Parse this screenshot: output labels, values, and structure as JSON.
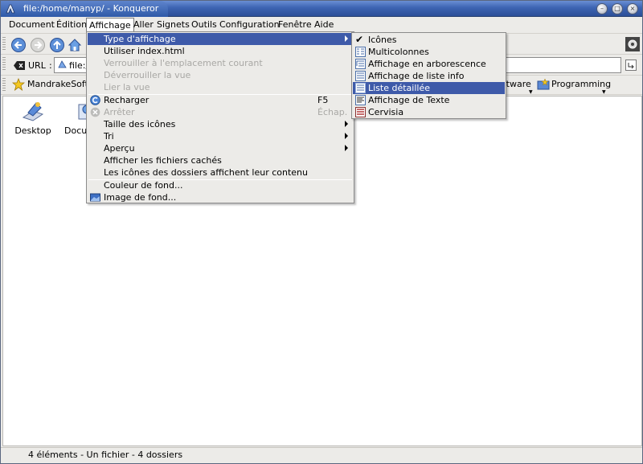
{
  "window": {
    "title": "file:/home/manyp/ - Konqueror"
  },
  "menubar": [
    "Document",
    "Édition",
    "Affichage",
    "Aller",
    "Signets",
    "Outils",
    "Configuration",
    "Fenêtre",
    "Aide"
  ],
  "toolbar": {
    "url_label": "URL",
    "url_value": "file:/"
  },
  "bookmarks": [
    "MandrakeSoft",
    "ftware",
    "Programming"
  ],
  "desktop_items": [
    "Desktop",
    "Docu"
  ],
  "status": "4 éléments - Un fichier - 4 dossiers",
  "affichage_menu": [
    {
      "label": "Type d'affichage"
    },
    {
      "label": "Utiliser index.html"
    },
    {
      "label": "Verrouiller à l'emplacement courant"
    },
    {
      "label": "Déverrouiller la vue"
    },
    {
      "label": "Lier la vue"
    },
    {
      "label": "Recharger",
      "shortcut": "F5"
    },
    {
      "label": "Arrêter",
      "shortcut": "Échap."
    },
    {
      "label": "Taille des icônes"
    },
    {
      "label": "Tri"
    },
    {
      "label": "Aperçu"
    },
    {
      "label": "Afficher les fichiers cachés"
    },
    {
      "label": "Les icônes des dossiers affichent leur contenu"
    },
    {
      "label": "Couleur de fond..."
    },
    {
      "label": "Image de fond..."
    }
  ],
  "type_menu": [
    "Icônes",
    "Multicolonnes",
    "Affichage en arborescence",
    "Affichage de liste info",
    "Liste détaillée",
    "Affichage de Texte",
    "Cervisia"
  ],
  "colors": {
    "highlight": "#3e5aa9",
    "titlebar": "#3d64b2"
  }
}
